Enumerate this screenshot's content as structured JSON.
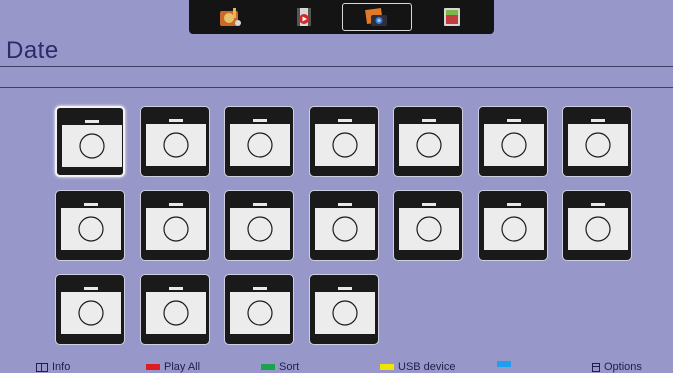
{
  "header": {
    "title": "Date"
  },
  "tabs": [
    {
      "icon": "music-icon",
      "active": false
    },
    {
      "icon": "video-icon",
      "active": false
    },
    {
      "icon": "photo-icon",
      "active": true
    },
    {
      "icon": "files-icon",
      "active": false
    }
  ],
  "grid": {
    "item_icon": "camera-icon",
    "items": [
      {
        "selected": true
      },
      {},
      {},
      {},
      {},
      {},
      {},
      {},
      {},
      {},
      {},
      {},
      {},
      {},
      {},
      {},
      {},
      {}
    ]
  },
  "footer": {
    "info": "Info",
    "play_all": "Play All",
    "sort": "Sort",
    "usb": "USB device",
    "blue": "",
    "options": "Options",
    "colors": {
      "red": "#e11b22",
      "green": "#1aa34a",
      "yellow": "#f2e400",
      "blue": "#1e9ff0"
    }
  }
}
